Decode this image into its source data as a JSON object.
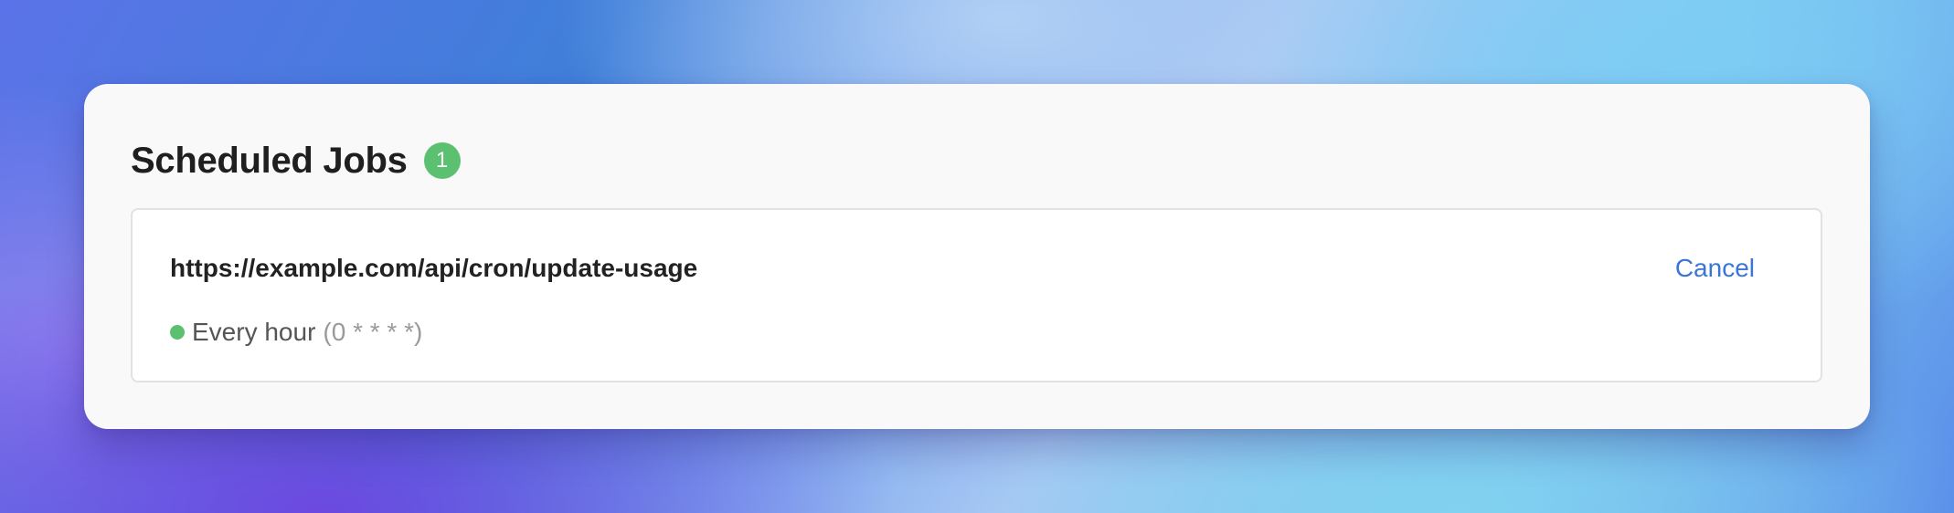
{
  "colors": {
    "accent_green": "#5cc071",
    "link_blue": "#3a76d8"
  },
  "panel": {
    "title": "Scheduled Jobs",
    "count": "1"
  },
  "jobs": [
    {
      "url": "https://example.com/api/cron/update-usage",
      "cancel_label": "Cancel",
      "status": "active",
      "schedule_label": "Every hour",
      "cron": "(0 * * * *)"
    }
  ]
}
